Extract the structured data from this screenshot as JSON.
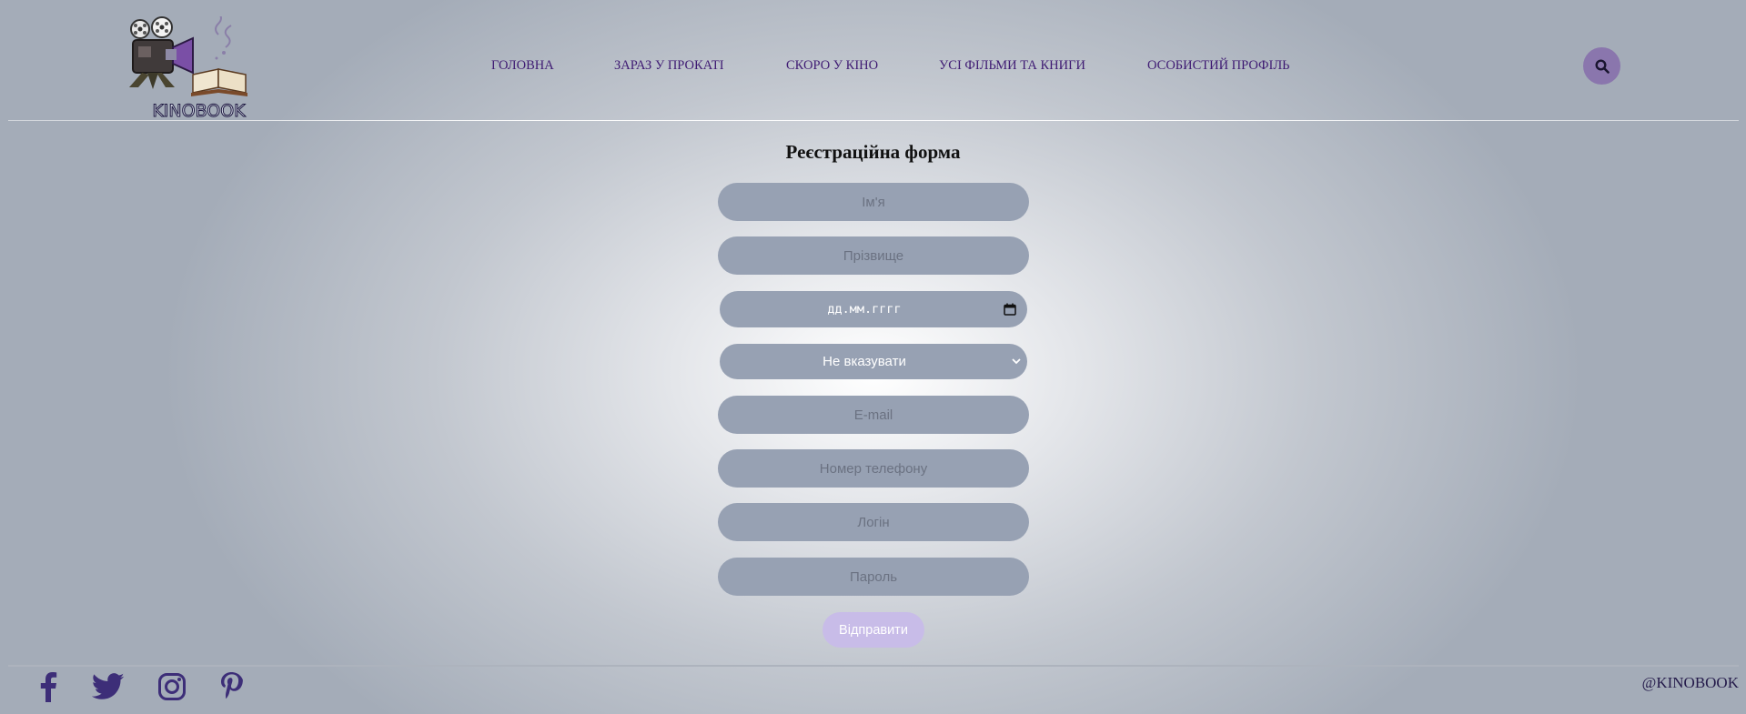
{
  "brand": {
    "name": "KINOBOOK",
    "logo_icon": "movie-camera-book-logo"
  },
  "nav": {
    "items": [
      {
        "label": "ГОЛОВНА"
      },
      {
        "label": "ЗАРАЗ У ПРОКАТІ"
      },
      {
        "label": "СКОРО У КІНО"
      },
      {
        "label": "УСІ ФІЛЬМИ ТА КНИГИ"
      },
      {
        "label": "ОСОБИСТИЙ ПРОФІЛЬ"
      }
    ],
    "color": "#3f1b73"
  },
  "search": {
    "icon": "search-icon",
    "bg_color": "#8a76ad"
  },
  "form": {
    "title": "Реєстраційна форма",
    "first_name_placeholder": "Ім'я",
    "last_name_placeholder": "Прізвище",
    "birthdate_placeholder": "дд.мм.гггг",
    "gender_selected": "Не вказувати",
    "email_placeholder": "E-mail",
    "phone_placeholder": "Номер телефону",
    "login_placeholder": "Логін",
    "password_placeholder": "Пароль",
    "submit_label": "Відправити",
    "field_color": "#97a1b3",
    "submit_color": "#c8bce8"
  },
  "footer": {
    "social_icons": [
      "facebook-icon",
      "twitter-icon",
      "instagram-icon",
      "pinterest-icon"
    ],
    "handle": "@KINOBOOK",
    "icon_color": "#3d2e78"
  }
}
